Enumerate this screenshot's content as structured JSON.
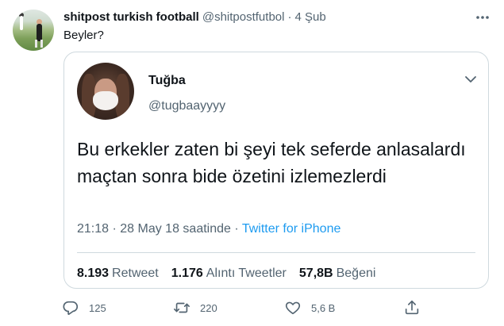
{
  "author": {
    "name": "shitpost turkish football",
    "handle": "@shitpostfutbol",
    "separator": "·",
    "date": "4 Şub",
    "avatar_icon": "football-players-photo"
  },
  "tweet_text": "Beyler?",
  "quoted": {
    "name": "Tuğba",
    "handle": "@tugbaayyyy",
    "avatar_icon": "masked-woman-photo",
    "text": "Bu erkekler zaten bi şeyi tek seferde anlasalardı maçtan sonra bide özetini izlemezlerdi",
    "time": "21:18",
    "separator1": " · ",
    "date_text": "28 May 18 saatinde",
    "separator2": " · ",
    "source": "Twitter for iPhone",
    "stats": [
      {
        "value": "8.193",
        "label": "Retweet"
      },
      {
        "value": "1.176",
        "label": "Alıntı Tweetler"
      },
      {
        "value": "57,8B",
        "label": "Beğeni"
      }
    ]
  },
  "actions": {
    "replies": "125",
    "retweets": "220",
    "likes": "5,6 B"
  },
  "colors": {
    "text": "#0f1419",
    "secondary": "#536471",
    "link": "#1d9bf0",
    "border": "#cfd9de"
  }
}
